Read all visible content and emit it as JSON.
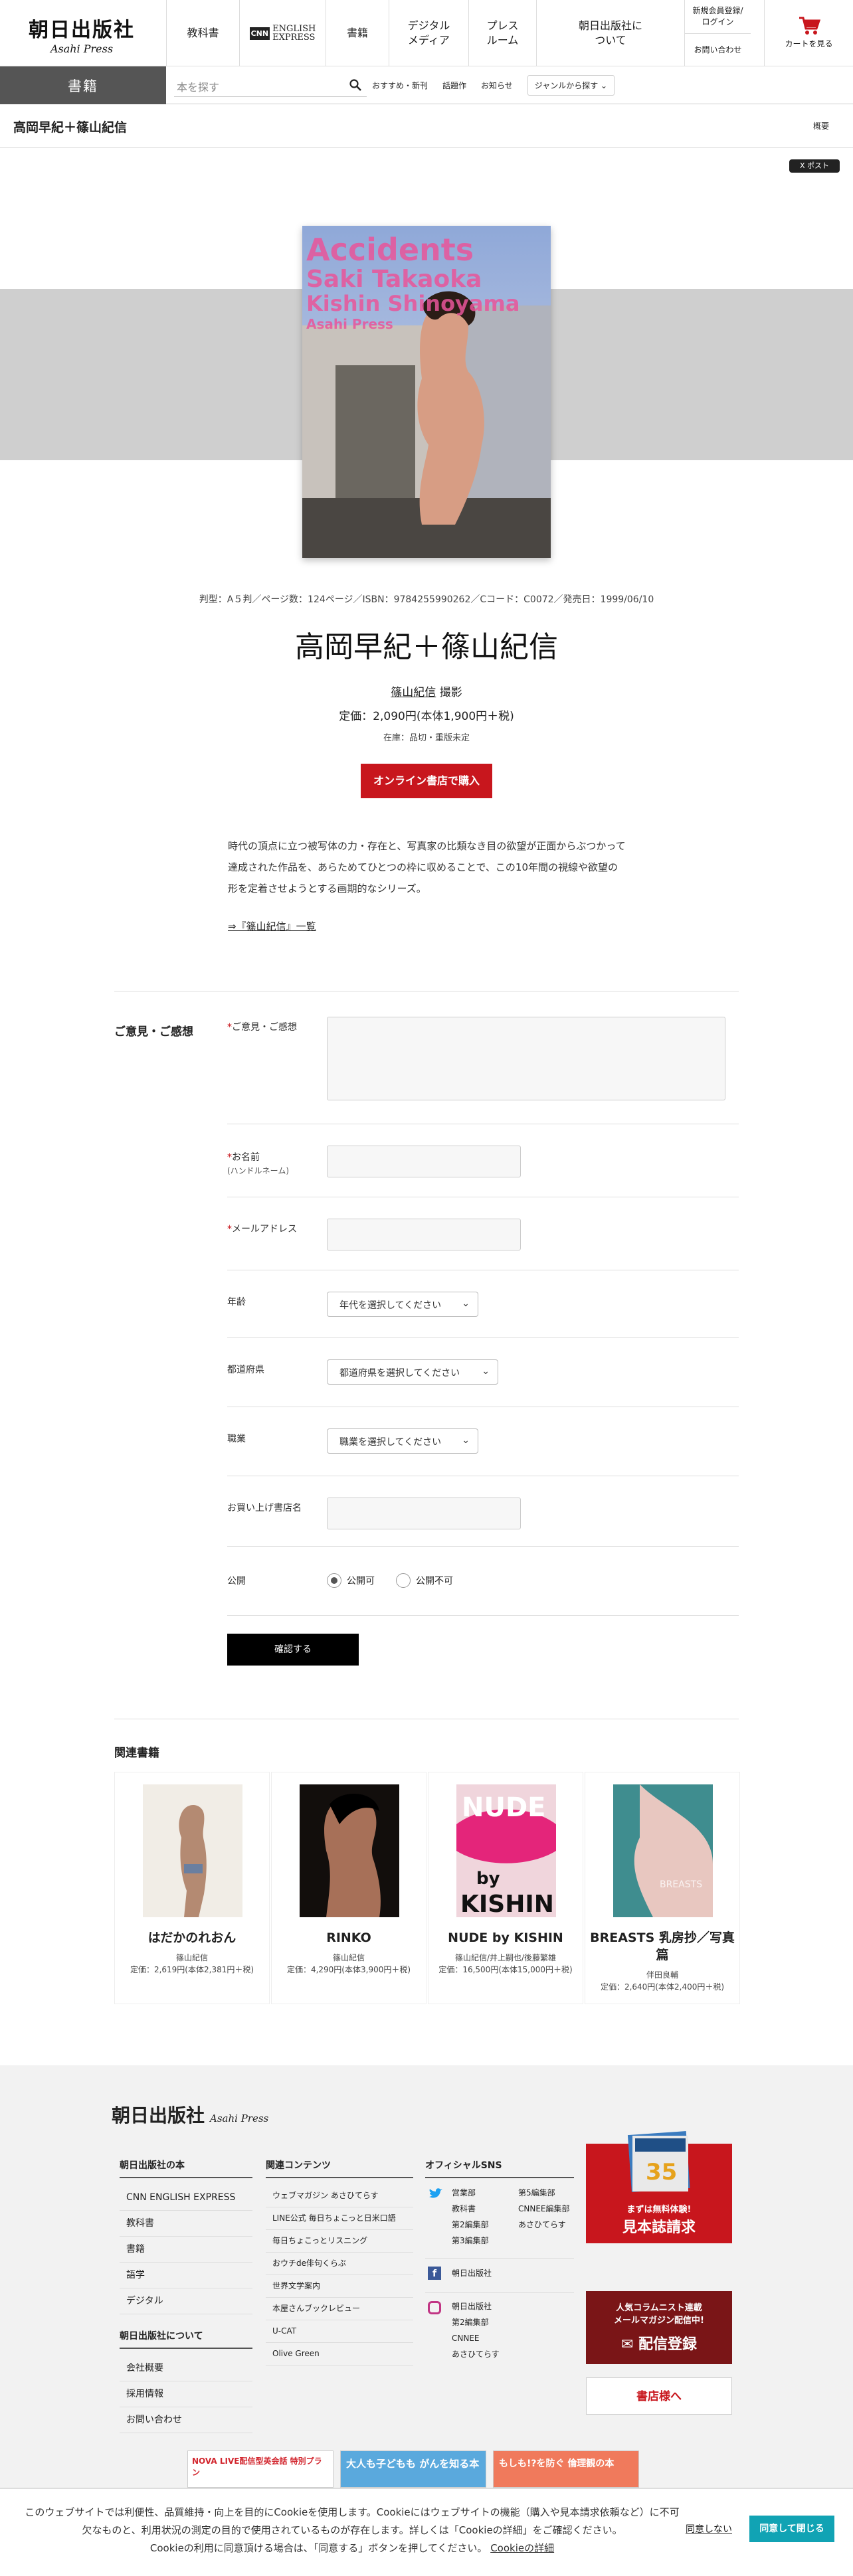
{
  "header": {
    "logo_jp": "朝日出版社",
    "logo_en": "Asahi Press",
    "nav": [
      "教科書",
      "書籍",
      "デジタル\nメディア",
      "プレス\nルーム",
      "朝日出版社に\nついて"
    ],
    "cnn_box": "CNN",
    "cnn_text": "ENGLISH\nEXPRESS",
    "login": "新規会員登録/\nログイン",
    "contact": "お問い合わせ",
    "cart": "カートを見る"
  },
  "subnav": {
    "category": "書籍",
    "search_placeholder": "本を探す",
    "links": [
      "おすすめ・新刊",
      "話題作",
      "お知らせ"
    ],
    "genre": "ジャンルから探す"
  },
  "titlebar": {
    "title": "高岡早紀＋篠山紀信",
    "overview": "概要"
  },
  "tweet": "X ポスト",
  "book": {
    "cover_text": [
      "Accidents",
      "Saki Takaoka",
      "Kishin Shinoyama",
      "Asahi Press"
    ],
    "meta": "判型：A５判／ページ数：124ページ／ISBN：9784255990262／Cコード：C0072／発売日：1999/06/10",
    "title": "高岡早紀＋篠山紀信",
    "author": "篠山紀信",
    "author_role": " 撮影",
    "price": "定価：2,090円(本体1,900円＋税)",
    "stock": "在庫：品切・重版未定",
    "buy": "オンライン書店で購入",
    "description": "時代の頂点に立つ被写体の力・存在と、写真家の比類なき目の欲望が正面からぶつかって達成された作品を、あらためてひとつの枠に収めることで、この10年間の視線や欲望の形を定着させようとする画期的なシリーズ。",
    "series_link": "⇒『篠山紀信』一覧"
  },
  "form": {
    "heading": "ご意見・ご感想",
    "opinion": "ご意見・ご感想",
    "name": "お名前",
    "name_sub": "(ハンドルネーム)",
    "email": "メールアドレス",
    "age": "年齢",
    "age_select": "年代を選択してください",
    "pref": "都道府県",
    "pref_select": "都道府県を選択してください",
    "job": "職業",
    "job_select": "職業を選択してください",
    "store": "お買い上げ書店名",
    "public": "公開",
    "public_yes": "公開可",
    "public_no": "公開不可",
    "confirm": "確認する"
  },
  "related": {
    "heading": "関連書籍",
    "books": [
      {
        "title": "はだかのれおん",
        "author": "篠山紀信",
        "price": "定価：2,619円(本体2,381円＋税)"
      },
      {
        "title": "RINKO",
        "author": "篠山紀信",
        "price": "定価：4,290円(本体3,900円＋税)"
      },
      {
        "title": "NUDE by KISHIN",
        "author": "篠山紀信/井上嗣也/後藤繁雄",
        "price": "定価：16,500円(本体15,000円＋税)"
      },
      {
        "title": "BREASTS 乳房抄／写真篇",
        "author": "伴田良輔",
        "price": "定価：2,640円(本体2,400円＋税)"
      }
    ]
  },
  "footer": {
    "logo_jp": "朝日出版社",
    "logo_en": "Asahi Press",
    "books_head": "朝日出版社の本",
    "books": [
      "CNN ENGLISH EXPRESS",
      "教科書",
      "書籍",
      "語学",
      "デジタル"
    ],
    "about_head": "朝日出版社について",
    "about": [
      "会社概要",
      "採用情報",
      "お問い合わせ"
    ],
    "content_head": "関連コンテンツ",
    "content": [
      "ウェブマガジン あさひてらす",
      "LINE公式 毎日ちょこっと日米口語",
      "毎日ちょこっとリスニング",
      "おウチde俳句くらぶ",
      "世界文学案内",
      "本屋さんブックレビュー",
      "U-CAT",
      "Olive Green"
    ],
    "sns_head": "オフィシャルSNS",
    "sns_twitter": [
      "営業部",
      "教科書",
      "第2編集部",
      "第3編集部",
      "第5編集部",
      "CNNEE編集部",
      "あさひてらす"
    ],
    "sns_facebook": [
      "朝日出版社"
    ],
    "sns_instagram": [
      "朝日出版社",
      "第2編集部",
      "CNNEE",
      "あさひてらす"
    ],
    "ad1_small": "まずは無料体験!",
    "ad1_big": "見本誌請求",
    "ad2_small": "人気コラムニスト連載\nメールマガジン配信中!",
    "ad2_big": "配信登録",
    "ad3": "書店様へ",
    "banner1": "NOVA LIVE配信型英会話 特別プラン",
    "banner2": "大人も子どもも がんを知る本",
    "banner3": "もしも!?を防ぐ 倫理観の本"
  },
  "cookie": {
    "text1": "このウェブサイトでは利便性、品質維持・向上を目的にCookieを使用します。Cookieにはウェブサイトの機能（購入や見本請求依頼など）に不可欠なものと、利用状況の測定の目的で使用されているものが存在します。詳しくは「Cookieの詳細」をご確認ください。",
    "text2": "Cookieの利用に同意頂ける場合は、「同意する」ボタンを押してください。",
    "detail": "Cookieの詳細",
    "decline": "同意しない",
    "accept": "同意して閉じる"
  },
  "colors": {
    "accent": "#c8161d",
    "cookie_button": "#11a3b4"
  }
}
